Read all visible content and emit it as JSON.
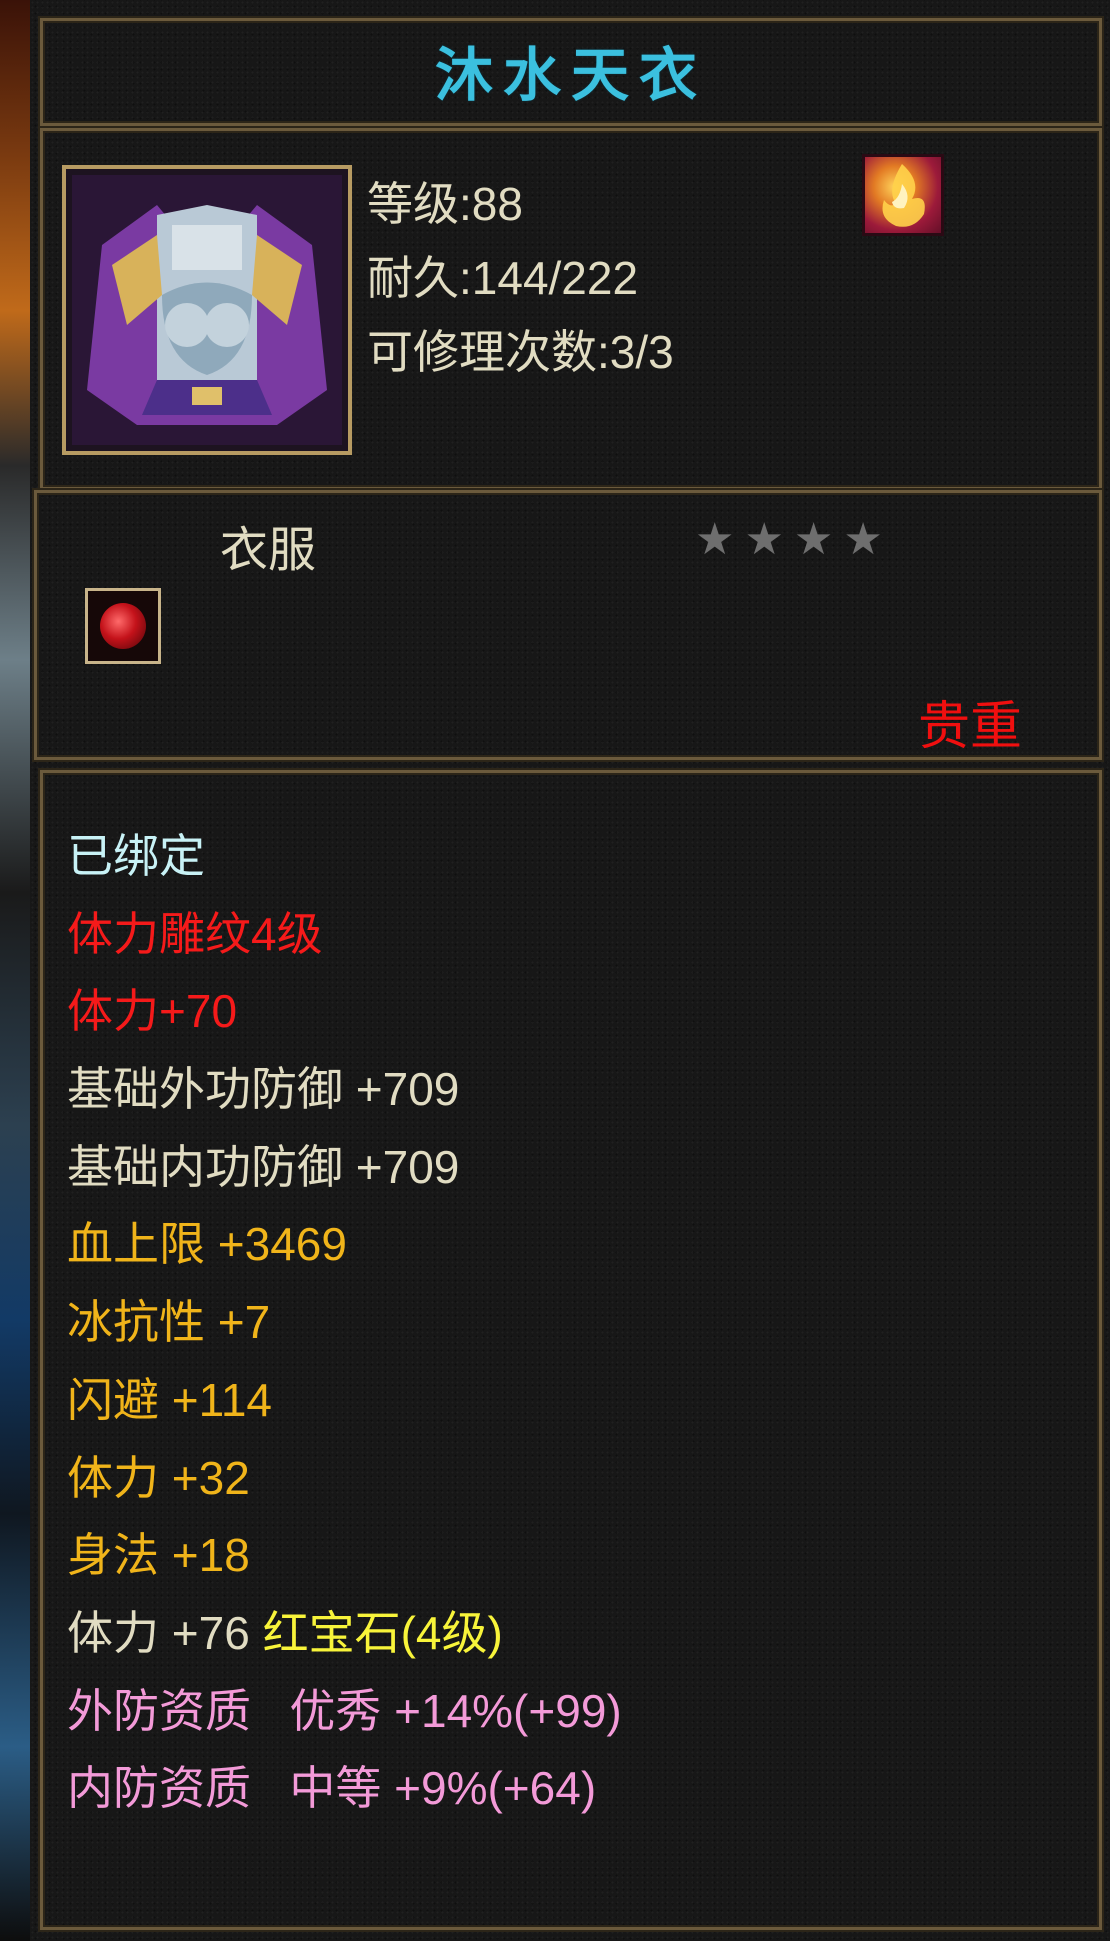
{
  "item": {
    "name": "沐水天衣",
    "level": "等级:88",
    "durability": "耐久:144/222",
    "repair_count": "可修理次数:3/3",
    "type": "衣服",
    "rarity": "贵重",
    "stars_total": 4,
    "icon": "robe-icon"
  },
  "attributes": [
    {
      "text": "已绑定",
      "color": "#c8f2f6"
    },
    {
      "text": "体力雕纹4级",
      "color": "#f51a1a"
    },
    {
      "text": "体力+70",
      "color": "#f51a1a"
    },
    {
      "text": "基础外功防御 +709",
      "color": "#e1dcc2"
    },
    {
      "text": "基础内功防御 +709",
      "color": "#e1dcc2"
    },
    {
      "text": "血上限 +3469",
      "color": "#f0b41a"
    },
    {
      "text": "冰抗性 +7",
      "color": "#f0b41a"
    },
    {
      "text": "闪避 +114",
      "color": "#f0b41a"
    },
    {
      "text": "体力 +32",
      "color": "#f0b41a"
    },
    {
      "text": "身法 +18",
      "color": "#f0b41a"
    }
  ],
  "gem_line": {
    "stat": "体力 +76",
    "gem": "红宝石(4级)"
  },
  "quality": [
    {
      "text": "外防资质   优秀 +14%(+99)"
    },
    {
      "text": "内防资质   中等 +9%(+64)"
    }
  ],
  "colors": {
    "title": "#3bc0df",
    "frame": "#6b5a3c",
    "rarity": "#f00f0f",
    "star_inactive": "#6e6e6e"
  }
}
